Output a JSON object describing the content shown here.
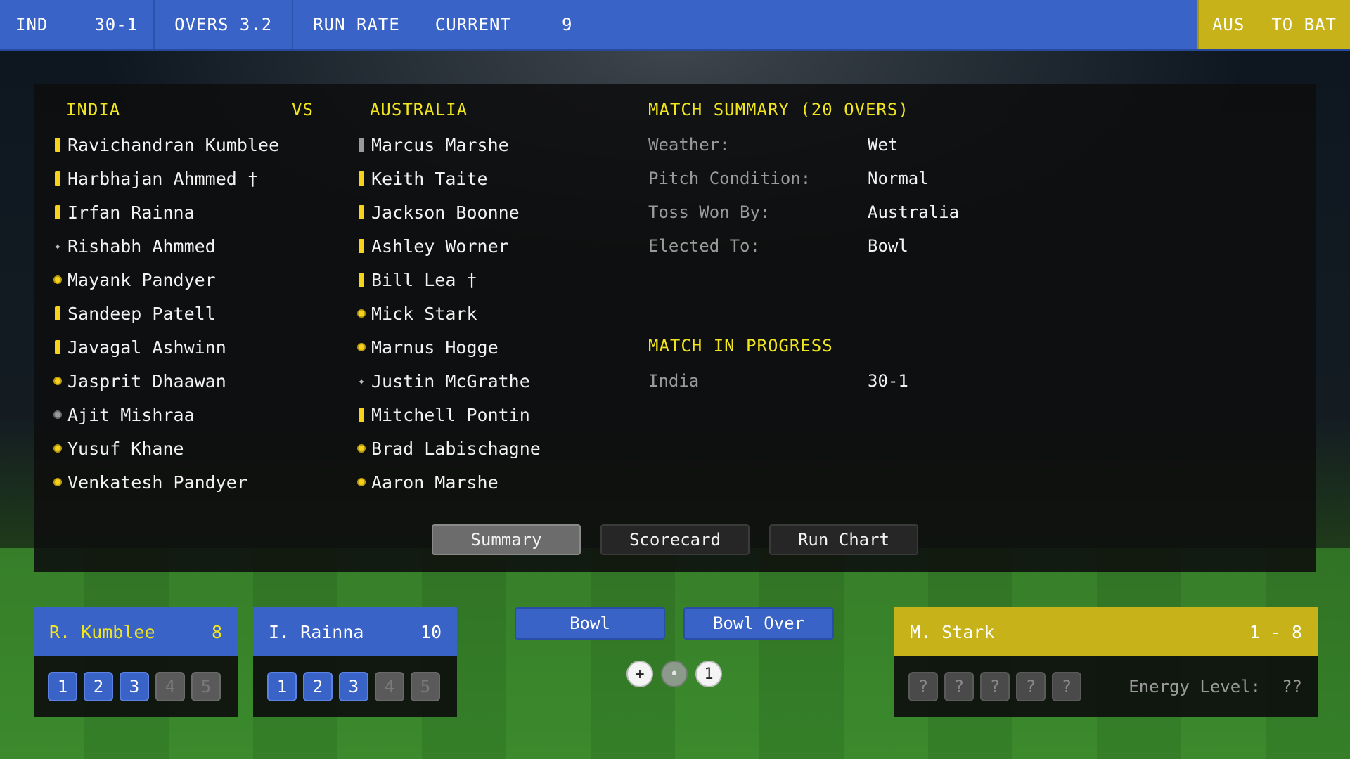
{
  "topbar": {
    "team": "IND",
    "score": "30-1",
    "overs": "OVERS 3.2",
    "run_rate_label": "RUN RATE",
    "current_label": "CURRENT",
    "current_value": "9",
    "next_team": "AUS",
    "next_status": "TO BAT"
  },
  "header": {
    "team1": "INDIA",
    "vs": "VS",
    "team2": "AUSTRALIA",
    "summary_title": "MATCH SUMMARY (20 OVERS)",
    "progress_title": "MATCH IN PROGRESS"
  },
  "india_players": [
    {
      "name": "Ravichandran Kumblee",
      "role": "bat"
    },
    {
      "name": "Harbhajan Ahmmed †",
      "role": "bat"
    },
    {
      "name": "Irfan Rainna",
      "role": "bat"
    },
    {
      "name": "Rishabh Ahmmed",
      "role": "star"
    },
    {
      "name": "Mayank Pandyer",
      "role": "ball"
    },
    {
      "name": "Sandeep Patell",
      "role": "bat"
    },
    {
      "name": "Javagal Ashwinn",
      "role": "bat"
    },
    {
      "name": "Jasprit Dhaawan",
      "role": "ball"
    },
    {
      "name": "Ajit Mishraa",
      "role": "ball-grey"
    },
    {
      "name": "Yusuf Khane",
      "role": "ball"
    },
    {
      "name": "Venkatesh Pandyer",
      "role": "ball"
    }
  ],
  "australia_players": [
    {
      "name": "Marcus Marshe",
      "role": "bat-grey"
    },
    {
      "name": "Keith Taite",
      "role": "bat"
    },
    {
      "name": "Jackson Boonne",
      "role": "bat"
    },
    {
      "name": "Ashley Worner",
      "role": "bat"
    },
    {
      "name": "Bill Lea †",
      "role": "bat"
    },
    {
      "name": "Mick Stark",
      "role": "ball"
    },
    {
      "name": "Marnus Hogge",
      "role": "ball"
    },
    {
      "name": "Justin McGrathe",
      "role": "star"
    },
    {
      "name": "Mitchell Pontin",
      "role": "bat"
    },
    {
      "name": "Brad Labischagne",
      "role": "ball"
    },
    {
      "name": "Aaron Marshe",
      "role": "ball"
    }
  ],
  "summary": [
    {
      "label": "Weather:",
      "value": "Wet"
    },
    {
      "label": "Pitch Condition:",
      "value": "Normal"
    },
    {
      "label": "Toss Won By:",
      "value": "Australia"
    },
    {
      "label": "Elected To:",
      "value": "Bowl"
    }
  ],
  "progress": {
    "team": "India",
    "score": "30-1"
  },
  "tabs": {
    "summary": "Summary",
    "scorecard": "Scorecard",
    "run_chart": "Run Chart"
  },
  "batsman1": {
    "name": "R. Kumblee",
    "runs": "8",
    "shots": [
      "1",
      "2",
      "3",
      "4",
      "5"
    ],
    "enabled": 3
  },
  "batsman2": {
    "name": "I. Rainna",
    "runs": "10",
    "shots": [
      "1",
      "2",
      "3",
      "4",
      "5"
    ],
    "enabled": 3
  },
  "actions": {
    "bowl": "Bowl",
    "bowl_over": "Bowl Over"
  },
  "ball_indicators": [
    "+",
    "•",
    "1"
  ],
  "bowler": {
    "name": "M. Stark",
    "figures": "1 - 8",
    "unknown": "?",
    "energy_label": "Energy Level:",
    "energy_value": "??"
  },
  "colors": {
    "blue": "#3a63c8",
    "gold": "#c7b21a",
    "yellow_text": "#f1e61e"
  }
}
